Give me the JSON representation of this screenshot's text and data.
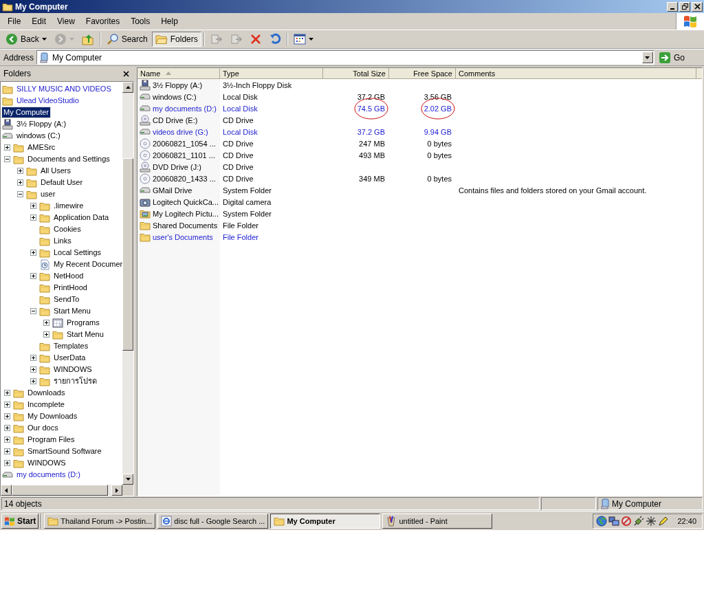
{
  "window": {
    "title": "My Computer"
  },
  "menu": [
    "File",
    "Edit",
    "View",
    "Favorites",
    "Tools",
    "Help"
  ],
  "toolbar": [
    {
      "kind": "back",
      "label": "Back",
      "disabled": false,
      "pressed": false
    },
    {
      "kind": "forward",
      "disabled": true,
      "pressed": false
    },
    {
      "kind": "up",
      "disabled": false,
      "pressed": false
    },
    {
      "kind": "search",
      "label": "Search",
      "disabled": false,
      "pressed": false
    },
    {
      "kind": "folders",
      "label": "Folders",
      "disabled": false,
      "pressed": true
    },
    {
      "kind": "move",
      "disabled": true,
      "pressed": false
    },
    {
      "kind": "copy",
      "disabled": true,
      "pressed": false
    },
    {
      "kind": "delete",
      "disabled": false,
      "pressed": false
    },
    {
      "kind": "undo",
      "disabled": false,
      "pressed": false
    },
    {
      "kind": "views",
      "disabled": false,
      "pressed": false
    }
  ],
  "address": {
    "label": "Address",
    "value": "My Computer",
    "go": "Go"
  },
  "folders_pane": {
    "title": "Folders",
    "tree": [
      {
        "label": "SILLY MUSIC AND VIDEOS",
        "kind": "folder",
        "compressed": true,
        "selected": false
      },
      {
        "label": "Ulead VideoStudio",
        "kind": "folder",
        "compressed": true,
        "selected": false
      },
      {
        "label": "My Computer",
        "compressed": false,
        "selected": true
      },
      {
        "label": "3½ Floppy (A:)",
        "kind": "floppy",
        "compressed": false,
        "selected": false
      },
      {
        "label": "windows (C:)",
        "kind": "drive",
        "compressed": false,
        "selected": false,
        "children": [
          {
            "label": "AMESrc",
            "kind": "folder",
            "expanded": false,
            "compressed": false,
            "selected": false
          },
          {
            "label": "Documents and Settings",
            "kind": "folder",
            "expanded": true,
            "compressed": false,
            "selected": false,
            "children": [
              {
                "label": "All Users",
                "kind": "folder",
                "expanded": false,
                "compressed": false,
                "selected": false
              },
              {
                "label": "Default User",
                "kind": "folder",
                "expanded": false,
                "compressed": false,
                "selected": false
              },
              {
                "label": "user",
                "kind": "folder",
                "expanded": true,
                "compressed": false,
                "selected": false,
                "children": [
                  {
                    "label": ".limewire",
                    "kind": "folder",
                    "expanded": false,
                    "compressed": false,
                    "selected": false
                  },
                  {
                    "label": "Application Data",
                    "kind": "folder",
                    "expanded": false,
                    "compressed": false,
                    "selected": false
                  },
                  {
                    "label": "Cookies",
                    "kind": "folder",
                    "compressed": false,
                    "selected": false
                  },
                  {
                    "label": "Links",
                    "kind": "folder",
                    "compressed": false,
                    "selected": false
                  },
                  {
                    "label": "Local Settings",
                    "kind": "folder",
                    "expanded": false,
                    "compressed": false,
                    "selected": false
                  },
                  {
                    "label": "My Recent Documer",
                    "kind": "recent",
                    "compressed": false,
                    "selected": false
                  },
                  {
                    "label": "NetHood",
                    "kind": "folder",
                    "expanded": false,
                    "compressed": false,
                    "selected": false
                  },
                  {
                    "label": "PrintHood",
                    "kind": "folder",
                    "compressed": false,
                    "selected": false
                  },
                  {
                    "label": "SendTo",
                    "kind": "folder",
                    "compressed": false,
                    "selected": false
                  },
                  {
                    "label": "Start Menu",
                    "kind": "folder",
                    "expanded": true,
                    "compressed": false,
                    "selected": false,
                    "children": [
                      {
                        "label": "Programs",
                        "kind": "programs",
                        "expanded": false,
                        "compressed": false,
                        "selected": false
                      },
                      {
                        "label": "Start Menu",
                        "kind": "folder",
                        "expanded": false,
                        "compressed": false,
                        "selected": false
                      }
                    ]
                  },
                  {
                    "label": "Templates",
                    "kind": "folder",
                    "compressed": false,
                    "selected": false
                  },
                  {
                    "label": "UserData",
                    "kind": "folder",
                    "expanded": false,
                    "compressed": false,
                    "selected": false
                  },
                  {
                    "label": "WINDOWS",
                    "kind": "folder",
                    "expanded": false,
                    "compressed": false,
                    "selected": false
                  },
                  {
                    "label": "รายการโปรด",
                    "kind": "folder",
                    "expanded": false,
                    "compressed": false,
                    "selected": false
                  }
                ]
              }
            ]
          },
          {
            "label": "Downloads",
            "kind": "folder",
            "expanded": false,
            "compressed": false,
            "selected": false
          },
          {
            "label": "Incomplete",
            "kind": "folder",
            "expanded": false,
            "compressed": false,
            "selected": false
          },
          {
            "label": "My Downloads",
            "kind": "folder",
            "expanded": false,
            "compressed": false,
            "selected": false
          },
          {
            "label": "Our docs",
            "kind": "folder",
            "expanded": false,
            "compressed": false,
            "selected": false
          },
          {
            "label": "Program Files",
            "kind": "folder",
            "expanded": false,
            "compressed": false,
            "selected": false
          },
          {
            "label": "SmartSound Software",
            "kind": "folder",
            "expanded": false,
            "compressed": false,
            "selected": false
          },
          {
            "label": "WINDOWS",
            "kind": "folder",
            "expanded": false,
            "compressed": false,
            "selected": false
          }
        ]
      },
      {
        "label": "my documents (D:)",
        "kind": "drive",
        "compressed": true,
        "selected": false
      }
    ]
  },
  "list": {
    "columns": [
      {
        "label": "Name",
        "sorted": true
      },
      {
        "label": "Type",
        "sorted": false
      },
      {
        "label": "Total Size",
        "sorted": false
      },
      {
        "label": "Free Space",
        "sorted": false
      },
      {
        "label": "Comments",
        "sorted": false
      }
    ],
    "rows": [
      {
        "name": "3½ Floppy (A:)",
        "type": "3½-Inch Floppy Disk",
        "kind": "floppy",
        "compressed": false,
        "circled": false
      },
      {
        "name": "windows (C:)",
        "type": "Local Disk",
        "total_size": "37.2 GB",
        "free_space": "3.56 GB",
        "kind": "drive",
        "compressed": false,
        "circled": false
      },
      {
        "name": "my documents (D:)",
        "type": "Local Disk",
        "total_size": "74.5 GB",
        "free_space": "2.02 GB",
        "kind": "drive",
        "compressed": true,
        "circled": true
      },
      {
        "name": "CD Drive (E:)",
        "type": "CD Drive",
        "kind": "cd",
        "compressed": false,
        "circled": false
      },
      {
        "name": "videos drive (G:)",
        "type": "Local Disk",
        "total_size": "37.2 GB",
        "free_space": "9.94 GB",
        "kind": "drive",
        "compressed": true,
        "circled": false
      },
      {
        "name": "20060821_1054 ...",
        "type": "CD Drive",
        "total_size": "247 MB",
        "free_space": "0 bytes",
        "kind": "disc",
        "compressed": false,
        "circled": false
      },
      {
        "name": "20060821_1101 ...",
        "type": "CD Drive",
        "total_size": "493 MB",
        "free_space": "0 bytes",
        "kind": "disc",
        "compressed": false,
        "circled": false
      },
      {
        "name": "DVD Drive (J:)",
        "type": "CD Drive",
        "kind": "cd",
        "compressed": false,
        "circled": false
      },
      {
        "name": "20060820_1433 ...",
        "type": "CD Drive",
        "total_size": "349 MB",
        "free_space": "0 bytes",
        "kind": "disc",
        "compressed": false,
        "circled": false
      },
      {
        "name": "GMail Drive",
        "type": "System Folder",
        "comments": "Contains files and folders stored on your Gmail account.",
        "kind": "drive",
        "compressed": false,
        "circled": false
      },
      {
        "name": "Logitech QuickCa...",
        "type": "Digital camera",
        "kind": "camera",
        "compressed": false,
        "circled": false
      },
      {
        "name": "My Logitech Pictu...",
        "type": "System Folder",
        "kind": "pictures",
        "compressed": false,
        "circled": false
      },
      {
        "name": "Shared Documents",
        "type": "File Folder",
        "kind": "folder",
        "compressed": false,
        "circled": false
      },
      {
        "name": "user's Documents",
        "type": "File Folder",
        "kind": "folder",
        "compressed": true,
        "circled": false
      }
    ]
  },
  "status_bar": {
    "count": "14 objects",
    "location": "My Computer"
  },
  "taskbar": {
    "start": "Start",
    "tasks": [
      {
        "label": "Thailand Forum -> Postin...",
        "kind": "folder",
        "selected": false
      },
      {
        "label": "disc full - Google Search ...",
        "kind": "ie",
        "selected": false
      },
      {
        "label": "My Computer",
        "kind": "folder",
        "selected": true
      },
      {
        "label": "untitled - Paint",
        "kind": "paint",
        "selected": false
      }
    ],
    "clock": "22:40"
  }
}
